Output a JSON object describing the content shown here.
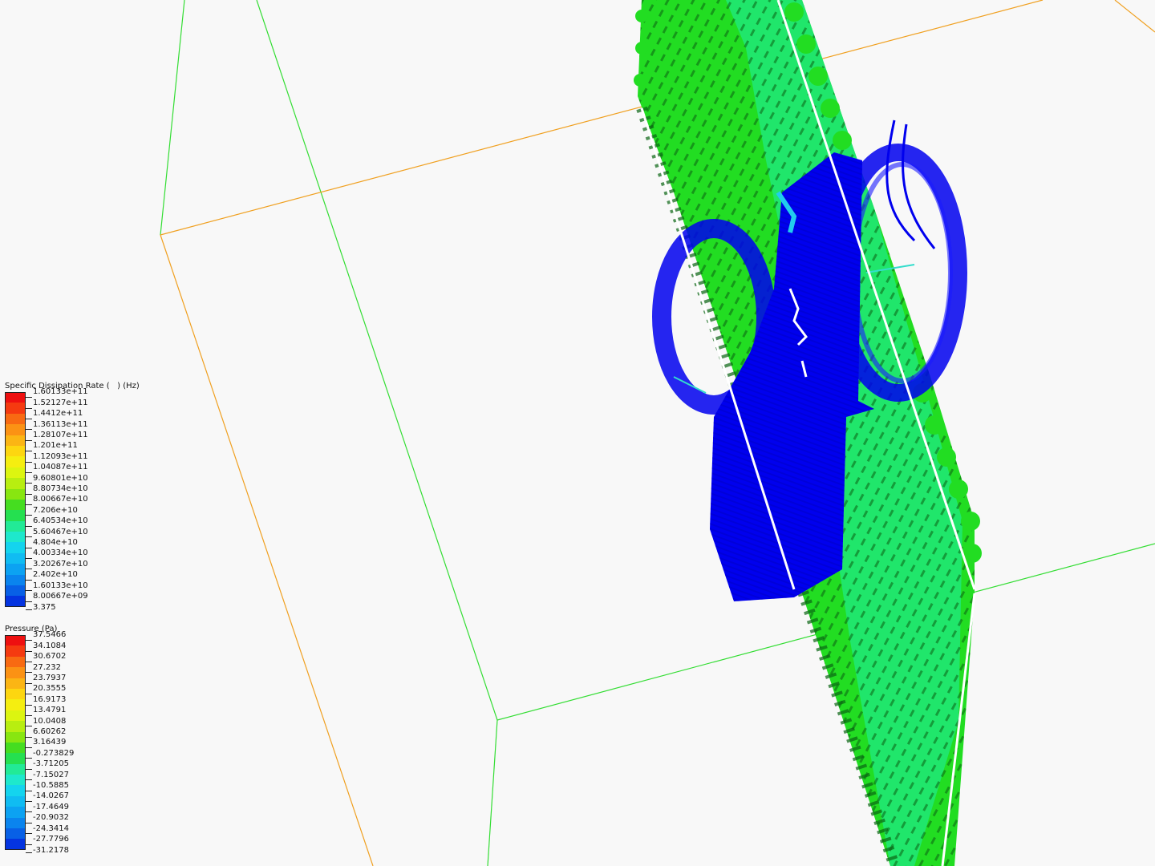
{
  "colors": {
    "background": "#f8f8f8",
    "box_green": "#33dd33",
    "box_orange": "#f0a020",
    "plane_green": "#22dd22",
    "plane_light": "#22ee88",
    "stream_blue": "#0000ee",
    "outline_white": "#ffffff"
  },
  "legends": [
    {
      "id": "specific-dissipation-rate",
      "title": "Specific Dissipation Rate (   ) (Hz)",
      "labels": [
        "1.60133e+11",
        "1.52127e+11",
        "1.4412e+11",
        "1.36113e+11",
        "1.28107e+11",
        "1.201e+11",
        "1.12093e+11",
        "1.04087e+11",
        "9.60801e+10",
        "8.80734e+10",
        "8.00667e+10",
        "7.206e+10",
        "6.40534e+10",
        "5.60467e+10",
        "4.804e+10",
        "4.00334e+10",
        "3.20267e+10",
        "2.402e+10",
        "1.60133e+10",
        "8.00667e+09",
        "3.375"
      ],
      "swatches": [
        "#ee1010",
        "#f53a10",
        "#f86a12",
        "#fb9214",
        "#fbb514",
        "#fdd610",
        "#f5ee10",
        "#dcf510",
        "#b8ee10",
        "#88e610",
        "#45dd20",
        "#25e050",
        "#22ea96",
        "#1ee8cc",
        "#14d4ee",
        "#10bcf2",
        "#0ca2f2",
        "#0a84ee",
        "#0860e6",
        "#0434e0"
      ]
    },
    {
      "id": "pressure",
      "title": "Pressure (Pa)",
      "labels": [
        "37.5466",
        "34.1084",
        "30.6702",
        "27.232",
        "23.7937",
        "20.3555",
        "16.9173",
        "13.4791",
        "10.0408",
        "6.60262",
        "3.16439",
        "-0.273829",
        "-3.71205",
        "-7.15027",
        "-10.5885",
        "-14.0267",
        "-17.4649",
        "-20.9032",
        "-24.3414",
        "-27.7796",
        "-31.2178"
      ],
      "swatches": [
        "#ee1010",
        "#f53a10",
        "#f86a12",
        "#fb9214",
        "#fbb514",
        "#fdd610",
        "#f5ee10",
        "#dcf510",
        "#b8ee10",
        "#88e610",
        "#45dd20",
        "#25e050",
        "#22ea96",
        "#1ee8cc",
        "#14d4ee",
        "#10bcf2",
        "#0ca2f2",
        "#0a84ee",
        "#0860e6",
        "#0434e0"
      ]
    }
  ]
}
